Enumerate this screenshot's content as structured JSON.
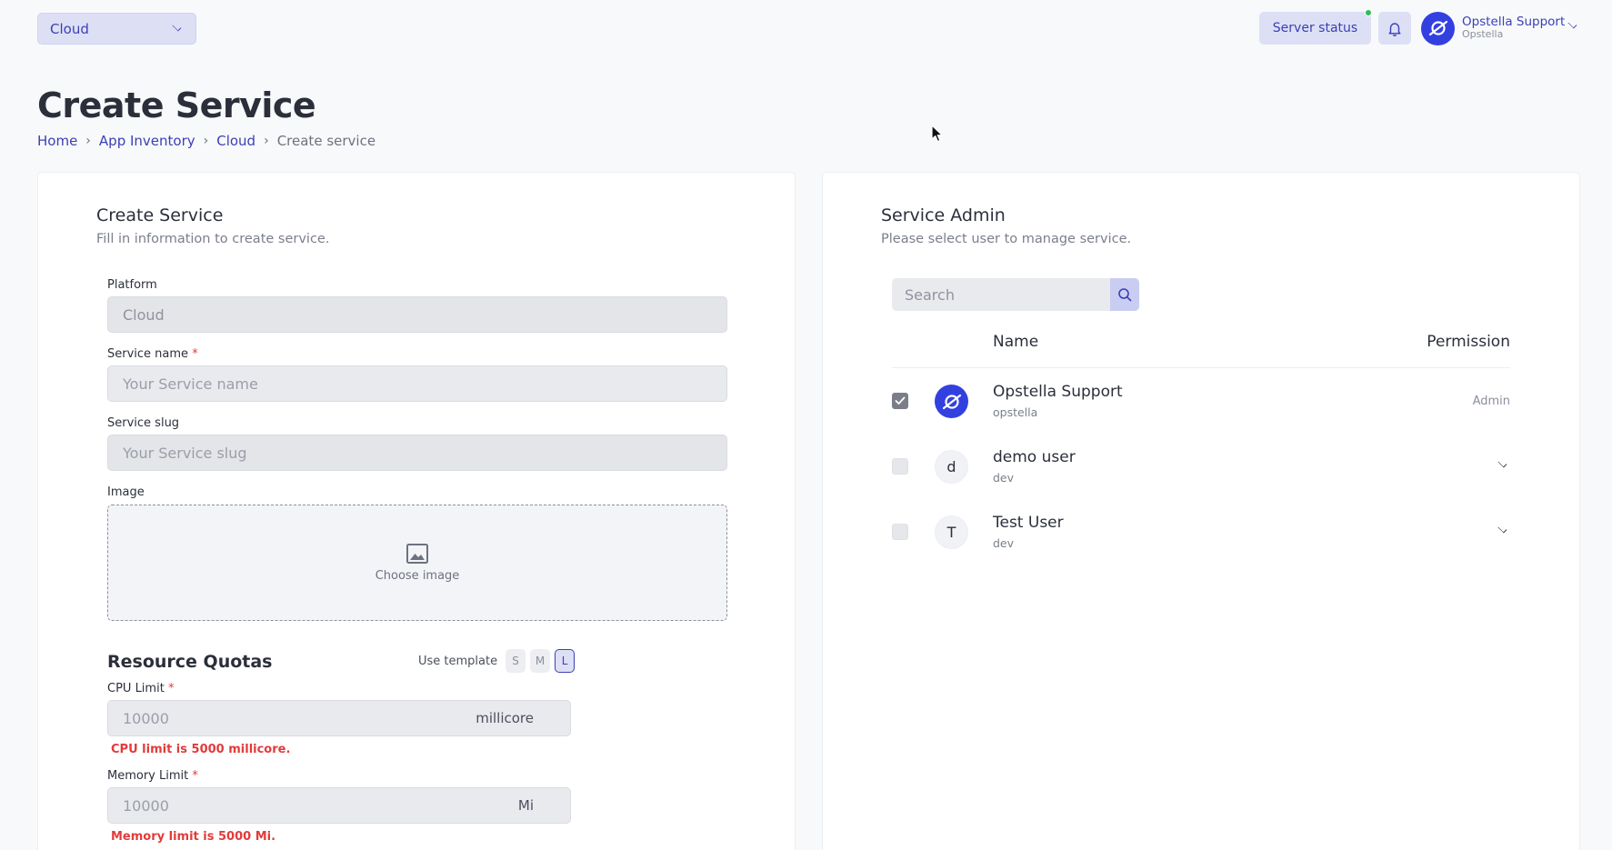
{
  "topbar": {
    "platform_select": "Cloud",
    "server_status": "Server status",
    "user": {
      "name": "Opstella Support",
      "org": "Opstella"
    }
  },
  "page": {
    "title": "Create Service",
    "breadcrumb": [
      "Home",
      "App Inventory",
      "Cloud",
      "Create service"
    ]
  },
  "create_card": {
    "title": "Create Service",
    "subtitle": "Fill in information to create service.",
    "platform": {
      "label": "Platform",
      "value": "Cloud"
    },
    "service_name": {
      "label": "Service name",
      "required": "*",
      "placeholder": "Your Service name"
    },
    "service_slug": {
      "label": "Service slug",
      "placeholder": "Your Service slug"
    },
    "image": {
      "label": "Image",
      "cta": "Choose image"
    },
    "resource_quotas": {
      "title": "Resource Quotas",
      "template_label": "Use template",
      "templates": [
        "S",
        "M",
        "L"
      ],
      "selected_template": "L",
      "cpu": {
        "label": "CPU Limit",
        "required": "*",
        "value": "10000",
        "unit": "millicore",
        "error": "CPU limit is 5000 millicore."
      },
      "memory": {
        "label": "Memory Limit",
        "required": "*",
        "value": "10000",
        "unit": "Mi",
        "error": "Memory limit is 5000 Mi."
      }
    }
  },
  "admin_card": {
    "title": "Service Admin",
    "subtitle": "Please select user to manage service.",
    "search_placeholder": "Search",
    "columns": {
      "name": "Name",
      "permission": "Permission"
    },
    "users": [
      {
        "name": "Opstella Support",
        "handle": "opstella",
        "avatar": "logo",
        "checked": true,
        "permission": "Admin"
      },
      {
        "name": "demo user",
        "handle": "dev",
        "avatar": "d",
        "checked": false,
        "permission": ""
      },
      {
        "name": "Test User",
        "handle": "dev",
        "avatar": "T",
        "checked": false,
        "permission": ""
      }
    ]
  },
  "icons": [
    "chevron-down-icon",
    "bell-icon",
    "search-icon",
    "image-icon",
    "check-icon",
    "opstella-logo-icon",
    "cursor-icon"
  ],
  "colors": {
    "accent": "#3b3fb6",
    "accent_bg": "#dde0f5",
    "error": "#e23b3b",
    "status_online": "#2bbd5b",
    "logo_blue": "#3340e0"
  }
}
